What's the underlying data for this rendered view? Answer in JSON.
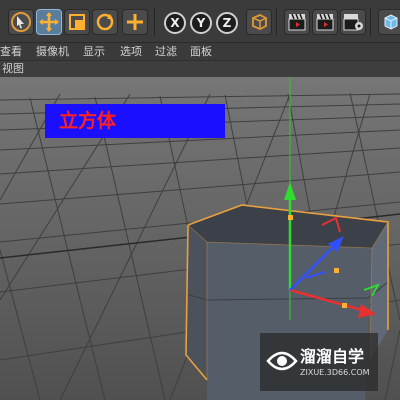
{
  "toolbar": {
    "tools": [
      "select-tool",
      "move-tool",
      "scale-tool",
      "rotate-tool",
      "create-object-tool"
    ],
    "axes": [
      "X",
      "Y",
      "Z"
    ],
    "render_buttons": [
      "render-view",
      "render-to-picture-viewer",
      "render-settings"
    ]
  },
  "menu": {
    "items": [
      "查看",
      "摄像机",
      "显示",
      "选项",
      "过滤",
      "面板"
    ]
  },
  "viewport": {
    "label": "视图",
    "object_label": "立方体"
  },
  "watermark": {
    "brand": "溜溜自学",
    "url": "ZIXUE.3D66.COM"
  },
  "colors": {
    "banner_bg": "#1a10ff",
    "banner_text": "#ff2020",
    "x_axis": "#e03030",
    "y_axis": "#30d030",
    "z_axis": "#3050ff",
    "selection_outline": "#e8a040"
  }
}
